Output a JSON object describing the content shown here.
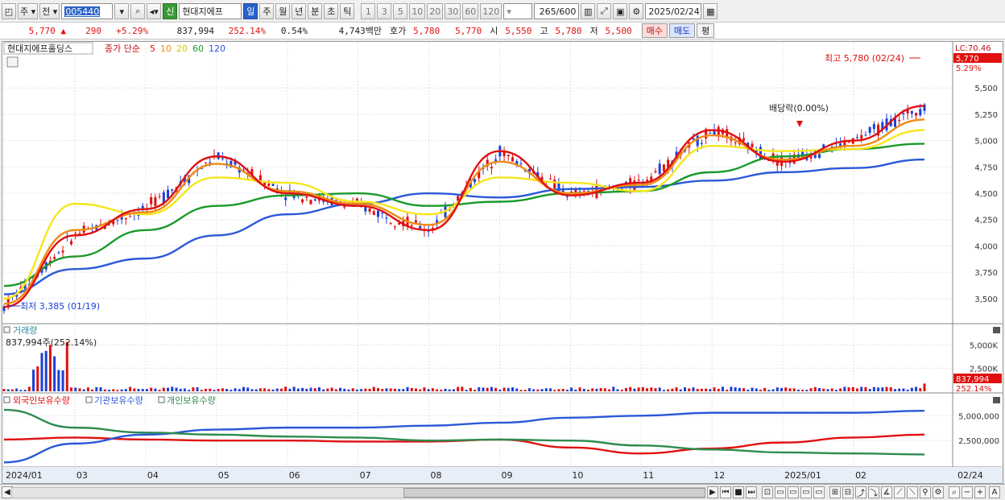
{
  "toolbar": {
    "type_label": "주",
    "period_label": "전",
    "stock_code": "005440",
    "signal_label": "신",
    "stock_name": "현대지에프",
    "timeframes": [
      "일",
      "주",
      "월",
      "년",
      "분",
      "초",
      "틱"
    ],
    "timeframe_selected": "일",
    "multipliers": [
      "1",
      "3",
      "5",
      "10",
      "20",
      "30",
      "60",
      "120"
    ],
    "count": "265",
    "count_max": "/600",
    "date": "2025/02/24"
  },
  "quote": {
    "price": "5,770",
    "arrow": "▲",
    "change": "290",
    "change_pct": "+5.29%",
    "volume": "837,994",
    "volume_ratio": "252.14%",
    "turnover": "0.54%",
    "amount": "4,743백만",
    "bid_label": "호가",
    "bid1": "5,780",
    "bid2": "5,770",
    "open_label": "시",
    "open": "5,550",
    "high_label": "고",
    "high": "5,780",
    "low_label": "저",
    "low": "5,500",
    "buy_label": "매수",
    "sell_label": "매도",
    "eval_label": "평"
  },
  "price_panel": {
    "title": "현대지에프홀딩스",
    "ma_label": "종가 단순",
    "ma_periods": [
      "5",
      "10",
      "20",
      "60",
      "120"
    ],
    "ma_colors": [
      "#e01010",
      "#f08a10",
      "#f5e61a",
      "#1a9a2a",
      "#2a58d8"
    ],
    "y_ticks": [
      "5,500",
      "5,250",
      "5,000",
      "4,750",
      "4,500",
      "4,250",
      "4,000",
      "3,750",
      "3,500"
    ],
    "lc_label": "LC:70.46",
    "price_tag": "5,770",
    "pct_tag": "5.29%",
    "max_label": "최고 5,780 (02/24)",
    "min_label": "최저 3,385 (01/19)",
    "dividend_label": "배당락(0.00%)"
  },
  "volume_panel": {
    "title": "거래량",
    "value_label": "837,994주(252.14%)",
    "y_ticks": [
      "5,000K",
      "2,500K"
    ],
    "tag_value": "837,994",
    "tag_pct": "252.14%"
  },
  "holdings_panel": {
    "series_labels": [
      "외국인보유수량",
      "기관보유수량",
      "개인보유수량"
    ],
    "series_colors": [
      "#e01010",
      "#2a58d8",
      "#2e8b4e"
    ],
    "y_ticks": [
      "5,000,000",
      "2,500,000"
    ]
  },
  "x_axis": {
    "labels": [
      "2024/01",
      "03",
      "04",
      "05",
      "06",
      "07",
      "08",
      "09",
      "10",
      "11",
      "12",
      "2025/01",
      "02"
    ],
    "current": "02/24"
  },
  "chart_data": {
    "type": "line",
    "title": "현대지에프홀딩스",
    "x": [
      "2024/01",
      "03",
      "04",
      "05",
      "06",
      "07",
      "08",
      "09",
      "10",
      "11",
      "12",
      "2025/01",
      "02",
      "02/24"
    ],
    "series": [
      {
        "name": "5",
        "values": [
          3420,
          4100,
          4350,
          4850,
          4500,
          4380,
          4150,
          4900,
          4480,
          4600,
          5100,
          4800,
          5000,
          5330
        ]
      },
      {
        "name": "10",
        "values": [
          3450,
          4150,
          4320,
          4780,
          4520,
          4400,
          4200,
          4800,
          4500,
          4580,
          5050,
          4820,
          4950,
          5200
        ]
      },
      {
        "name": "20",
        "values": [
          3500,
          4400,
          4300,
          4650,
          4600,
          4420,
          4300,
          4650,
          4600,
          4520,
          4950,
          4900,
          4920,
          5100
        ]
      },
      {
        "name": "60",
        "values": [
          3620,
          3900,
          4150,
          4380,
          4480,
          4500,
          4380,
          4420,
          4500,
          4520,
          4700,
          4850,
          4920,
          4970
        ]
      },
      {
        "name": "120",
        "values": [
          3540,
          3780,
          3880,
          4100,
          4300,
          4400,
          4500,
          4460,
          4540,
          4560,
          4620,
          4700,
          4740,
          4820
        ]
      }
    ],
    "ylim": [
      3300,
      5800
    ],
    "y_ticks": [
      3500,
      3750,
      4000,
      4250,
      4500,
      4750,
      5000,
      5250,
      5500
    ],
    "max": {
      "value": 5780,
      "date": "02/24"
    },
    "min": {
      "value": 3385,
      "date": "01/19"
    },
    "volume": {
      "ylim": [
        0,
        6000
      ],
      "last": 837994
    },
    "holdings": {
      "ylim": [
        0,
        6000000
      ],
      "series": [
        {
          "name": "외국인보유수량",
          "values": [
            2600000,
            2800000,
            2600000,
            2500000,
            2500000,
            2400000,
            2400000,
            2600000,
            1800000,
            1200000,
            1700000,
            2300000,
            2800000,
            3100000
          ]
        },
        {
          "name": "기관보유수량",
          "values": [
            300000,
            2200000,
            3100000,
            3600000,
            3800000,
            3800000,
            4000000,
            4300000,
            4800000,
            5000000,
            5300000,
            5300000,
            5300000,
            5500000
          ]
        },
        {
          "name": "개인보유수량",
          "values": [
            5600000,
            3800000,
            3300000,
            3100000,
            2900000,
            2800000,
            2500000,
            2600000,
            2500000,
            2000000,
            1600000,
            1300000,
            1200000,
            1100000
          ]
        }
      ]
    }
  }
}
